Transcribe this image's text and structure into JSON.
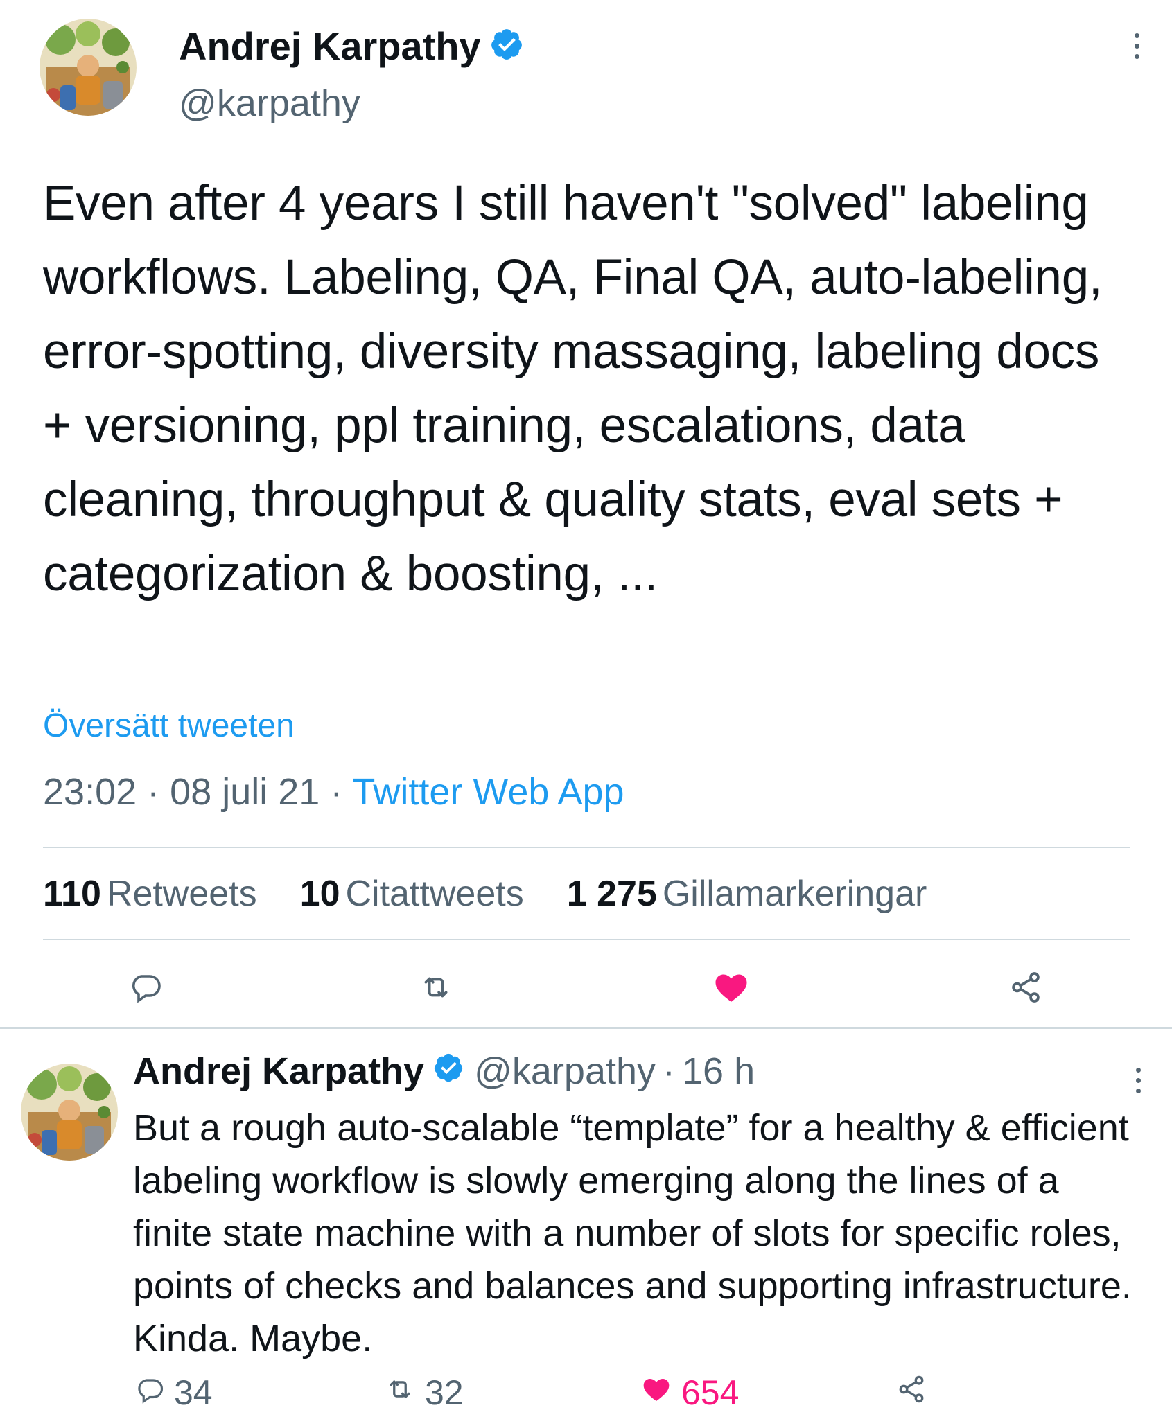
{
  "main_tweet": {
    "author_name": "Andrej Karpathy",
    "author_handle": "@karpathy",
    "text": "Even after 4 years I still haven't \"solved\" labeling workflows. Labeling, QA, Final QA, auto-labeling, error-spotting, diversity massaging, labeling docs + versioning, ppl training, escalations, data cleaning, throughput & quality stats, eval sets + categorization & boosting, ...",
    "translate_label": "Översätt tweeten",
    "time": "23:02",
    "date": "08 juli 21",
    "source": "Twitter Web App",
    "separator": "·",
    "stats": {
      "retweets_count": "110",
      "retweets_label": "Retweets",
      "quotes_count": "10",
      "quotes_label": "Citattweets",
      "likes_count": "1 275",
      "likes_label": "Gillamarkeringar"
    },
    "actions": [
      "reply-icon",
      "retweet-icon",
      "heart-icon-liked",
      "share-icon"
    ]
  },
  "reply_tweet": {
    "author_name": "Andrej Karpathy",
    "author_handle": "@karpathy",
    "separator": "·",
    "time": "16 h",
    "text": "But a rough auto-scalable “template” for a healthy & efficient labeling workflow is slowly emerging along the lines of a finite state machine with a number of slots for specific roles, points of checks and balances and supporting infrastructure. Kinda. Maybe.",
    "replies": "34",
    "retweets": "32",
    "likes": "654"
  },
  "colors": {
    "text": "#0f1419",
    "secondary": "#536471",
    "link": "#1d9bf0",
    "like": "#f91880",
    "divider": "#cfd9de"
  }
}
